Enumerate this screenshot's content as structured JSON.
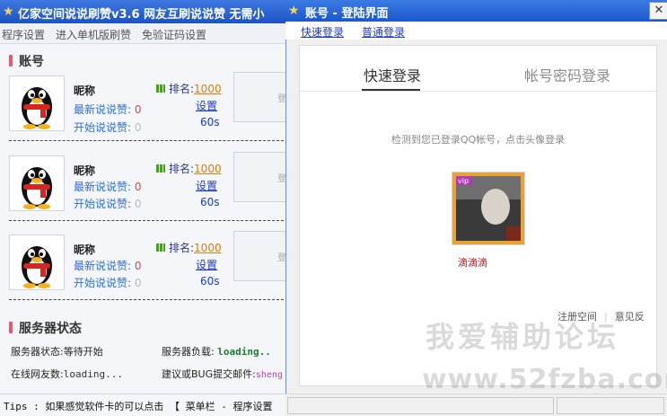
{
  "bg_window": {
    "title": "亿家空间说说刷赞v3.6 网友互刷说说赞 无需小",
    "menu": [
      "程序设置",
      "进入单机版刷赞",
      "免验证码设置"
    ],
    "account_section_title": "账号",
    "accounts": [
      {
        "nick": "昵称",
        "rank_label": "排名:",
        "rank_value": "1000",
        "latest_label": "最新说说赞:",
        "latest_value": "0",
        "start_label": "开始说说赞:",
        "start_value": "0",
        "settings": "设置",
        "seconds": "60s"
      },
      {
        "nick": "昵称",
        "rank_label": "排名:",
        "rank_value": "1000",
        "latest_label": "最新说说赞:",
        "latest_value": "0",
        "start_label": "开始说说赞:",
        "start_value": "0",
        "settings": "设置",
        "seconds": "60s"
      },
      {
        "nick": "昵称",
        "rank_label": "排名:",
        "rank_value": "1000",
        "latest_label": "最新说说赞:",
        "latest_value": "0",
        "start_label": "开始说说赞:",
        "start_value": "0",
        "settings": "设置",
        "seconds": "60s"
      }
    ],
    "server_section_title": "服务器状态",
    "server_status_label": "服务器状态:",
    "server_status_value": "等待开始",
    "server_load_label": "服务器负载:",
    "server_load_value": "loading..",
    "online_label": "在线网友数:",
    "online_value": "loading...",
    "bug_label": "建议或BUG提交邮件:",
    "bug_value": "sheng",
    "tips": "Tips : 如果感觉软件卡的可以点击 【 菜单栏 - 程序设置"
  },
  "login_window": {
    "title": "账号 - 登陆界面",
    "close_glyph": "✕",
    "top_links": [
      "快速登录",
      "普通登录"
    ],
    "tabs": [
      "快速登录",
      "帐号密码登录"
    ],
    "hint": "检测到您已登录QQ帐号，点击头像登录",
    "qq_nick": "滴滴滴",
    "bottom_links": [
      "注册空间",
      "意见反"
    ]
  },
  "watermark": {
    "line1": "我爱辅助论坛",
    "line2": "www.52fzba.com"
  },
  "colors": {
    "title_blue": "#1c53c6",
    "link_blue": "#1a3bc9",
    "accent_pink": "#e55a73",
    "red_value": "#e04545"
  },
  "icons": [
    "star-app-icon",
    "rank-bar-icon",
    "qq-penguin-avatar",
    "close-icon"
  ]
}
